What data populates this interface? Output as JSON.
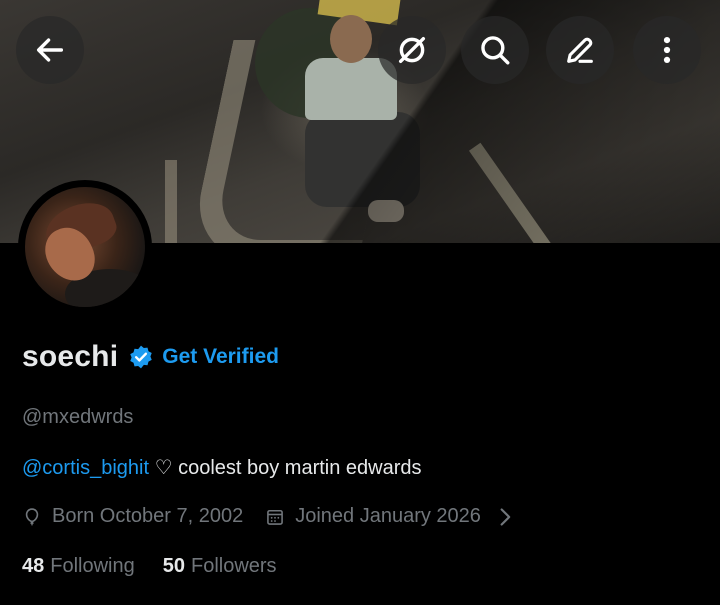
{
  "profile": {
    "display_name": "soechi",
    "get_verified_label": "Get Verified",
    "handle": "@mxedwrds",
    "bio_mention": "@cortis_bighit",
    "bio_text": " ♡ coolest boy martin edwards",
    "born": "Born October 7, 2002",
    "joined": "Joined January 2026",
    "following_count": "48",
    "following_label": "Following",
    "followers_count": "50",
    "followers_label": "Followers"
  },
  "header_actions": {
    "back_icon": "back-arrow-icon",
    "grok_icon": "grok-icon",
    "search_icon": "search-icon",
    "edit_icon": "edit-pencil-icon",
    "more_icon": "more-vertical-icon"
  },
  "colors": {
    "background": "#000000",
    "accent": "#1d9bf0",
    "secondary_text": "#71767b",
    "primary_text": "#e7e9ea"
  }
}
